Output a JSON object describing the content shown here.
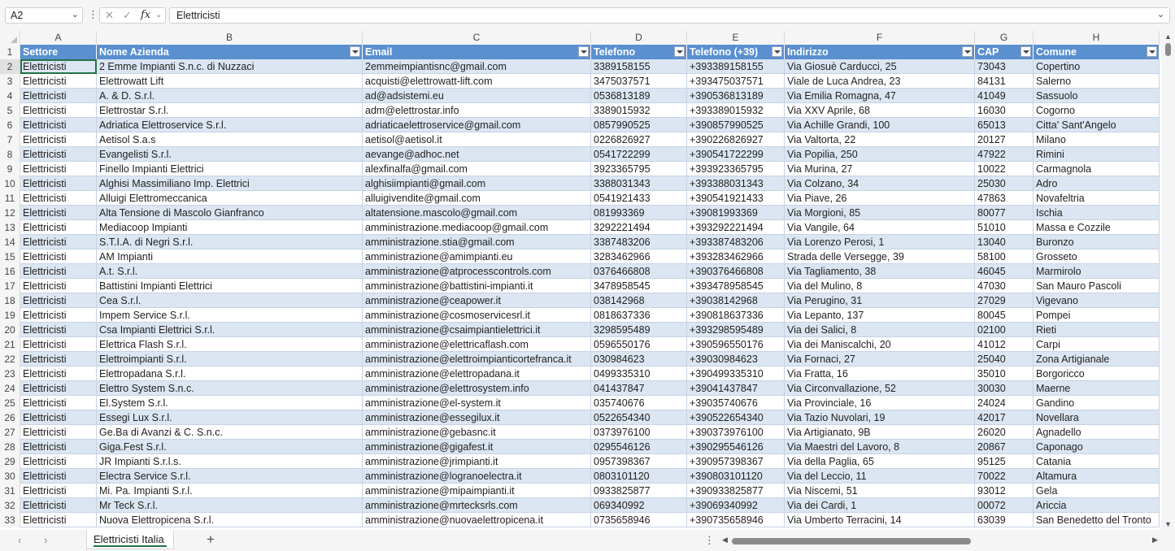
{
  "formula_bar": {
    "name_box": "A2",
    "cancel_glyph": "✕",
    "enter_glyph": "✓",
    "fx_label": "fx",
    "formula": "Elettricisti"
  },
  "columns": [
    "A",
    "B",
    "C",
    "D",
    "E",
    "F",
    "G",
    "H"
  ],
  "headers": [
    "Settore",
    "Nome Azienda",
    "Email",
    "Telefono",
    "Telefono (+39)",
    "Indirizzo",
    "CAP",
    "Comune"
  ],
  "row_numbers": [
    "1",
    "2",
    "3",
    "4",
    "5",
    "6",
    "7",
    "8",
    "9",
    "10",
    "11",
    "12",
    "13",
    "14",
    "15",
    "16",
    "17",
    "18",
    "19",
    "20",
    "21",
    "22",
    "23",
    "24",
    "25",
    "26",
    "27",
    "28",
    "29",
    "30",
    "31",
    "32",
    "33"
  ],
  "rows": [
    [
      "Elettricisti",
      "2 Emme Impianti S.n.c. di Nuzzaci",
      "2emmeimpiantisnc@gmail.com",
      "3389158155",
      "+393389158155",
      "Via Giosuè Carducci, 25",
      "73043",
      "Copertino"
    ],
    [
      "Elettricisti",
      "Elettrowatt Lift",
      "acquisti@elettrowatt-lift.com",
      "3475037571",
      "+393475037571",
      "Viale de Luca Andrea, 23",
      "84131",
      "Salerno"
    ],
    [
      "Elettricisti",
      "A. & D. S.r.l.",
      "ad@adsistemi.eu",
      "0536813189",
      "+390536813189",
      "Via Emilia Romagna, 47",
      "41049",
      "Sassuolo"
    ],
    [
      "Elettricisti",
      "Elettrostar S.r.l.",
      "adm@elettrostar.info",
      "3389015932",
      "+393389015932",
      "Via XXV Aprile, 68",
      "16030",
      "Cogorno"
    ],
    [
      "Elettricisti",
      "Adriatica Elettroservice S.r.l.",
      "adriaticaelettroservice@gmail.com",
      "0857990525",
      "+390857990525",
      "Via Achille Grandi, 100",
      "65013",
      "Citta' Sant'Angelo"
    ],
    [
      "Elettricisti",
      "Aetisol S.a.s",
      "aetisol@aetisol.it",
      "0226826927",
      "+390226826927",
      "Via Valtorta, 22",
      "20127",
      "Milano"
    ],
    [
      "Elettricisti",
      "Evangelisti S.r.l.",
      "aevange@adhoc.net",
      "0541722299",
      "+390541722299",
      "Via Popilia, 250",
      "47922",
      "Rimini"
    ],
    [
      "Elettricisti",
      "Finello Impianti Elettrici",
      "alexfinalfa@gmail.com",
      "3923365795",
      "+393923365795",
      "Via Murina, 27",
      "10022",
      "Carmagnola"
    ],
    [
      "Elettricisti",
      "Alghisi Massimiliano Imp. Elettrici",
      "alghisiimpianti@gmail.com",
      "3388031343",
      "+393388031343",
      "Via Colzano, 34",
      "25030",
      "Adro"
    ],
    [
      "Elettricisti",
      "Alluigi Elettromeccanica",
      "alluigivendite@gmail.com",
      "0541921433",
      "+390541921433",
      "Via Piave, 26",
      "47863",
      "Novafeltria"
    ],
    [
      "Elettricisti",
      "Alta Tensione di Mascolo Gianfranco",
      "altatensione.mascolo@gmail.com",
      "081993369",
      "+39081993369",
      "Via Morgioni, 85",
      "80077",
      "Ischia"
    ],
    [
      "Elettricisti",
      "Mediacoop Impianti",
      "amministrazione.mediacoop@gmail.com",
      "3292221494",
      "+393292221494",
      "Via Vangile, 64",
      "51010",
      "Massa e Cozzile"
    ],
    [
      "Elettricisti",
      "S.T.I.A. di Negri S.r.l.",
      "amministrazione.stia@gmail.com",
      "3387483206",
      "+393387483206",
      "Via Lorenzo Perosi, 1",
      "13040",
      "Buronzo"
    ],
    [
      "Elettricisti",
      "AM Impianti",
      "amministrazione@amimpianti.eu",
      "3283462966",
      "+393283462966",
      "Strada delle Versegge, 39",
      "58100",
      "Grosseto"
    ],
    [
      "Elettricisti",
      "A.t. S.r.l.",
      "amministrazione@atprocesscontrols.com",
      "0376466808",
      "+390376466808",
      "Via Tagliamento, 38",
      "46045",
      "Marmirolo"
    ],
    [
      "Elettricisti",
      "Battistini Impianti Elettrici",
      "amministrazione@battistini-impianti.it",
      "3478958545",
      "+393478958545",
      "Via del Mulino, 8",
      "47030",
      "San Mauro Pascoli"
    ],
    [
      "Elettricisti",
      "Cea S.r.l.",
      "amministrazione@ceapower.it",
      "038142968",
      "+39038142968",
      "Via Perugino, 31",
      "27029",
      "Vigevano"
    ],
    [
      "Elettricisti",
      "Impem Service S.r.l.",
      "amministrazione@cosmoservicesrl.it",
      "0818637336",
      "+390818637336",
      "Via Lepanto, 137",
      "80045",
      "Pompei"
    ],
    [
      "Elettricisti",
      "Csa Impianti Elettrici S.r.l.",
      "amministrazione@csaimpiantielettrici.it",
      "3298595489",
      "+393298595489",
      "Via dei Salici, 8",
      "02100",
      "Rieti"
    ],
    [
      "Elettricisti",
      "Elettrica Flash S.r.l.",
      "amministrazione@elettricaflash.com",
      "0596550176",
      "+390596550176",
      "Via dei Maniscalchi, 20",
      "41012",
      "Carpi"
    ],
    [
      "Elettricisti",
      "Elettroimpianti S.r.l.",
      "amministrazione@elettroimpianticortefranca.it",
      "030984623",
      "+39030984623",
      "Via Fornaci, 27",
      "25040",
      "Zona Artigianale"
    ],
    [
      "Elettricisti",
      "Elettropadana S.r.l.",
      "amministrazione@elettropadana.it",
      "0499335310",
      "+390499335310",
      "Via Fratta, 16",
      "35010",
      "Borgoricco"
    ],
    [
      "Elettricisti",
      "Elettro System S.n.c.",
      "amministrazione@elettrosystem.info",
      "041437847",
      "+39041437847",
      "Via Circonvallazione, 52",
      "30030",
      "Maerne"
    ],
    [
      "Elettricisti",
      "El.System S.r.l.",
      "amministrazione@el-system.it",
      "035740676",
      "+39035740676",
      "Via Provinciale, 16",
      "24024",
      "Gandino"
    ],
    [
      "Elettricisti",
      "Essegi Lux S.r.l.",
      "amministrazione@essegilux.it",
      "0522654340",
      "+390522654340",
      "Via Tazio Nuvolari, 19",
      "42017",
      "Novellara"
    ],
    [
      "Elettricisti",
      "Ge.Ba di Avanzi & C. S.n.c.",
      "amministrazione@gebasnc.it",
      "0373976100",
      "+390373976100",
      "Via Artigianato, 9B",
      "26020",
      "Agnadello"
    ],
    [
      "Elettricisti",
      "Giga.Fest S.r.l.",
      "amministrazione@gigafest.it",
      "0295546126",
      "+390295546126",
      "Via Maestri del Lavoro, 8",
      "20867",
      "Caponago"
    ],
    [
      "Elettricisti",
      "JR Impianti S.r.l.s.",
      "amministrazione@jrimpianti.it",
      "0957398367",
      "+390957398367",
      "Via della Paglia, 65",
      "95125",
      "Catania"
    ],
    [
      "Elettricisti",
      "Electra Service S.r.l.",
      "amministrazione@logranoelectra.it",
      "0803101120",
      "+390803101120",
      "Via del Leccio, 11",
      "70022",
      "Altamura"
    ],
    [
      "Elettricisti",
      "Mi. Pa. Impianti S.r.l.",
      "amministrazione@mipaimpianti.it",
      "0933825877",
      "+390933825877",
      "Via Niscemi, 51",
      "93012",
      "Gela"
    ],
    [
      "Elettricisti",
      "Mr Teck S.r.l.",
      "amministrazione@mrtecksrls.com",
      "069340992",
      "+39069340992",
      "Via dei Cardi, 1",
      "00072",
      "Ariccia"
    ],
    [
      "Elettricisti",
      "Nuova Elettropicena S.r.l.",
      "amministrazione@nuovaelettropicena.it",
      "0735658946",
      "+390735658946",
      "Via Umberto Terracini, 14",
      "63039",
      "San Benedetto del Tronto"
    ]
  ],
  "sheet_tab": {
    "label": "Elettricisti Italia",
    "add_glyph": "+"
  },
  "colors": {
    "header_fill": "#5a8fd0",
    "band_fill": "#dce6f2",
    "accent": "#217346"
  },
  "icons": [
    "chevron-down-icon",
    "cancel-icon",
    "enter-icon",
    "fx-icon",
    "filter-dropdown-icon",
    "add-sheet-icon",
    "scroll-arrow-icon"
  ]
}
